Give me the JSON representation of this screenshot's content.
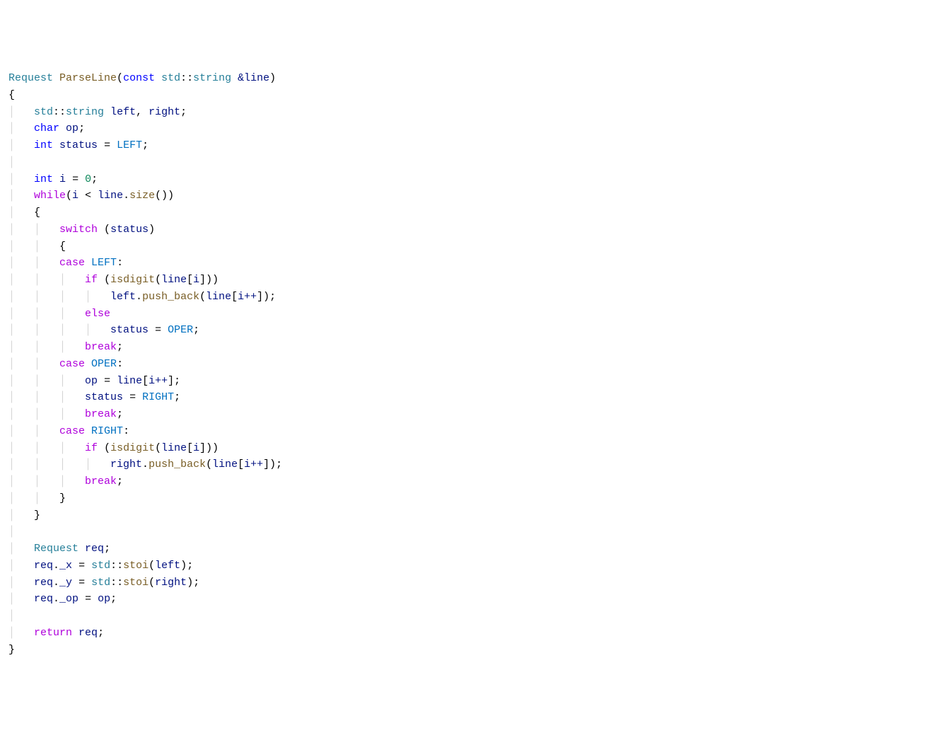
{
  "code": {
    "fn_return_type": "Request",
    "fn_name": "ParseLine",
    "kw_const": "const",
    "ns_std": "std",
    "type_string": "string",
    "amp_line": "&line",
    "decl_left": "left",
    "decl_right": "right",
    "kw_char": "char",
    "var_op": "op",
    "kw_int": "int",
    "var_status": "status",
    "enum_LEFT": "LEFT",
    "var_i": "i",
    "num_zero": "0",
    "kw_while": "while",
    "line_ident": "line",
    "method_size": "size",
    "kw_switch": "switch",
    "kw_case": "case",
    "kw_if": "if",
    "fn_isdigit": "isdigit",
    "method_push_back": "push_back",
    "inc_i": "i++",
    "kw_else": "else",
    "enum_OPER": "OPER",
    "kw_break": "break",
    "enum_RIGHT": "RIGHT",
    "var_req": "req",
    "field_x": "_x",
    "field_y": "_y",
    "field_op": "_op",
    "fn_stoi": "stoi",
    "kw_return": "return"
  }
}
